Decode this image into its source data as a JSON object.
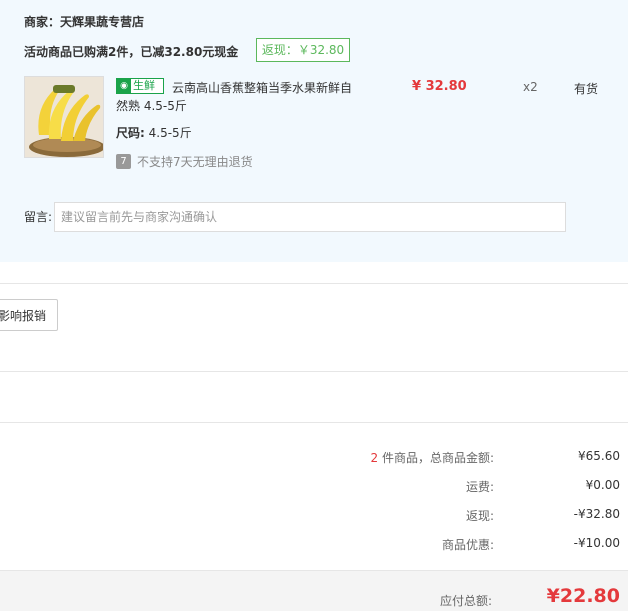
{
  "store": {
    "merchant": "商家：天辉果蔬专营店",
    "promo_text": "活动商品已购满2件，已减32.80元现金",
    "cashback_badge": "返现：￥32.80"
  },
  "product": {
    "tag_icon": "fresh-food-icon",
    "tag_label": "生鲜",
    "title": "云南高山香蕉整箱当季水果新鲜自然熟 4.5-5斤",
    "spec_label": "尺码:",
    "spec_value": "4.5-5斤",
    "no_return_icon_text": "7",
    "no_return_text": "不支持7天无理由退货",
    "price": "¥ 32.80",
    "qty": "x2",
    "stock": "有货"
  },
  "message": {
    "label": "留言:",
    "placeholder": "建议留言前先与商家沟通确认"
  },
  "reimburse_button": "影响报销",
  "summary": {
    "item_count": "2",
    "items_label": " 件商品，总商品金额:",
    "items_total": "¥65.60",
    "shipping_label": "运费:",
    "shipping_value": "¥0.00",
    "cashback_label": "返现:",
    "cashback_value": "-¥32.80",
    "discount_label": "商品优惠:",
    "discount_value": "-¥10.00",
    "payable_label": "应付总额:",
    "payable_value": "¥22.80"
  },
  "colors": {
    "accent_red": "#e4393c",
    "fresh_green": "#1aa34a",
    "panel_bg": "#f2f9fe"
  }
}
